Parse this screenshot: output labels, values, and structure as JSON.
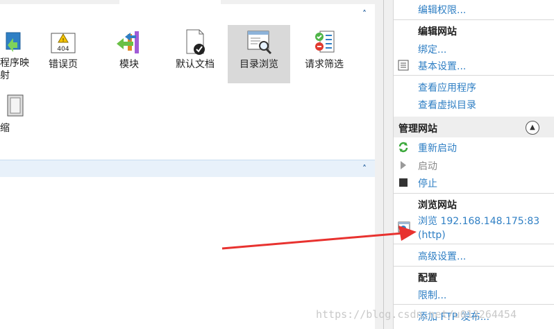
{
  "features": [
    {
      "label": "程序映\n射"
    },
    {
      "label": "错误页"
    },
    {
      "label": "模块"
    },
    {
      "label": "默认文档"
    },
    {
      "label": "目录浏览"
    },
    {
      "label": "请求筛选"
    },
    {
      "label": "缩"
    }
  ],
  "actions": {
    "edit_permissions": "编辑权限...",
    "edit_site_header": "编辑网站",
    "bindings": "绑定...",
    "basic_settings": "基本设置...",
    "view_applications": "查看应用程序",
    "view_virtual_dirs": "查看虚拟目录",
    "manage_site_header": "管理网站",
    "restart": "重新启动",
    "start": "启动",
    "stop": "停止",
    "browse_site_header": "浏览网站",
    "browse_link_line1": "浏览 192.168.148.175:83",
    "browse_link_line2": "(http)",
    "advanced_settings": "高级设置...",
    "config_header": "配置",
    "limits": "限制...",
    "add_ftp_publish": "添加 FTP 发布..."
  },
  "watermark": "https://blog.csdn.net/u013264454",
  "colors": {
    "link": "#2f7fc4",
    "arrow": "#e8322f",
    "selected": "#d9d9d9"
  }
}
